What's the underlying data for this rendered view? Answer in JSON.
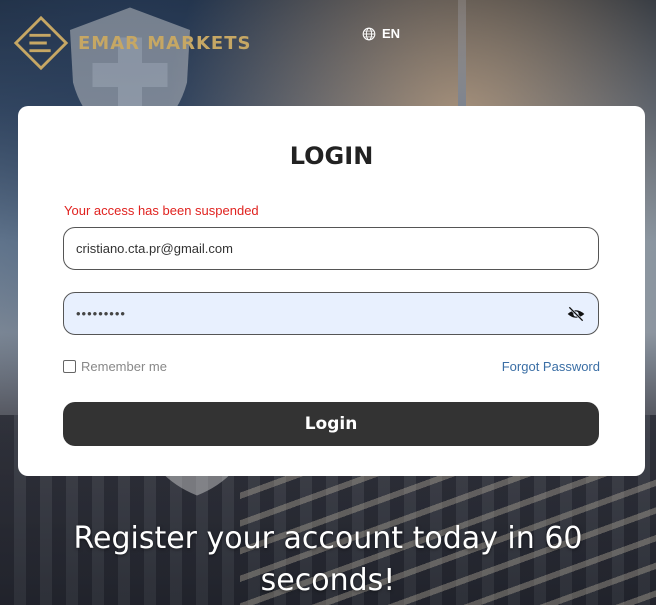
{
  "header": {
    "brand_name": "EMAR MARKETS",
    "logo_icon": "emar-markets-logo",
    "language_icon": "globe-icon",
    "language_code": "EN"
  },
  "login": {
    "title": "LOGIN",
    "error_message": "Your access has been suspended",
    "email_value": "cristiano.cta.pr@gmail.com",
    "password_masked": "•••••••••",
    "password_visibility_icon": "eye-off-icon",
    "remember_label": "Remember me",
    "remember_checked": false,
    "forgot_label": "Forgot Password",
    "submit_label": "Login"
  },
  "footer": {
    "register_line1": "Register your account today in 60",
    "register_line2": "seconds!"
  },
  "colors": {
    "brand_gold": "#c6a764",
    "error_red": "#e0221f",
    "button_bg": "#333333",
    "link_blue": "#3a6ea5",
    "autofill_bg": "#e8f0fe"
  }
}
